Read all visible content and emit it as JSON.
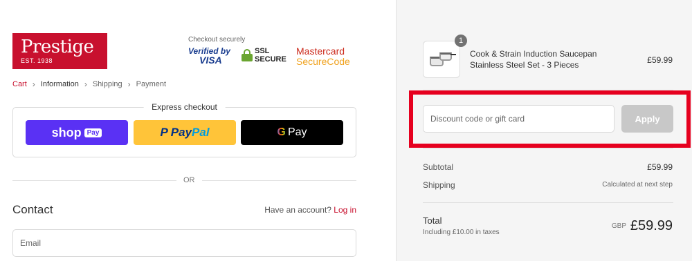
{
  "brand": {
    "name": "Prestige",
    "est": "EST. 1938"
  },
  "security": {
    "label": "Checkout securely",
    "visa_line1": "Verified by",
    "visa_line2": "VISA",
    "ssl_line1": "SSL",
    "ssl_line2": "SECURE",
    "mc_line1": "Mastercard",
    "mc_line2": "SecureCode"
  },
  "breadcrumb": [
    {
      "label": "Cart"
    },
    {
      "label": "Information"
    },
    {
      "label": "Shipping"
    },
    {
      "label": "Payment"
    }
  ],
  "express": {
    "title": "Express checkout",
    "shop_label": "shop",
    "shop_pay": "Pay",
    "paypal_1": "Pay",
    "paypal_2": "Pal",
    "gpay_label": "Pay"
  },
  "divider_text": "OR",
  "contact": {
    "title": "Contact",
    "account_prompt": "Have an account?",
    "login_link": "Log in",
    "email_placeholder": "Email"
  },
  "order": {
    "item": {
      "name": "Cook & Strain Induction Saucepan Stainless Steel Set - 3 Pieces",
      "price": "£59.99",
      "quantity": "1"
    },
    "discount_placeholder": "Discount code or gift card",
    "apply_label": "Apply",
    "subtotal_label": "Subtotal",
    "subtotal_value": "£59.99",
    "shipping_label": "Shipping",
    "shipping_value": "Calculated at next step",
    "total_label": "Total",
    "tax_note": "Including £10.00 in taxes",
    "currency": "GBP",
    "total_value": "£59.99"
  },
  "colors": {
    "brand_red": "#c8102e",
    "highlight_red": "#e6001f",
    "shop_purple": "#5a31f4",
    "paypal_yellow": "#ffc439"
  }
}
